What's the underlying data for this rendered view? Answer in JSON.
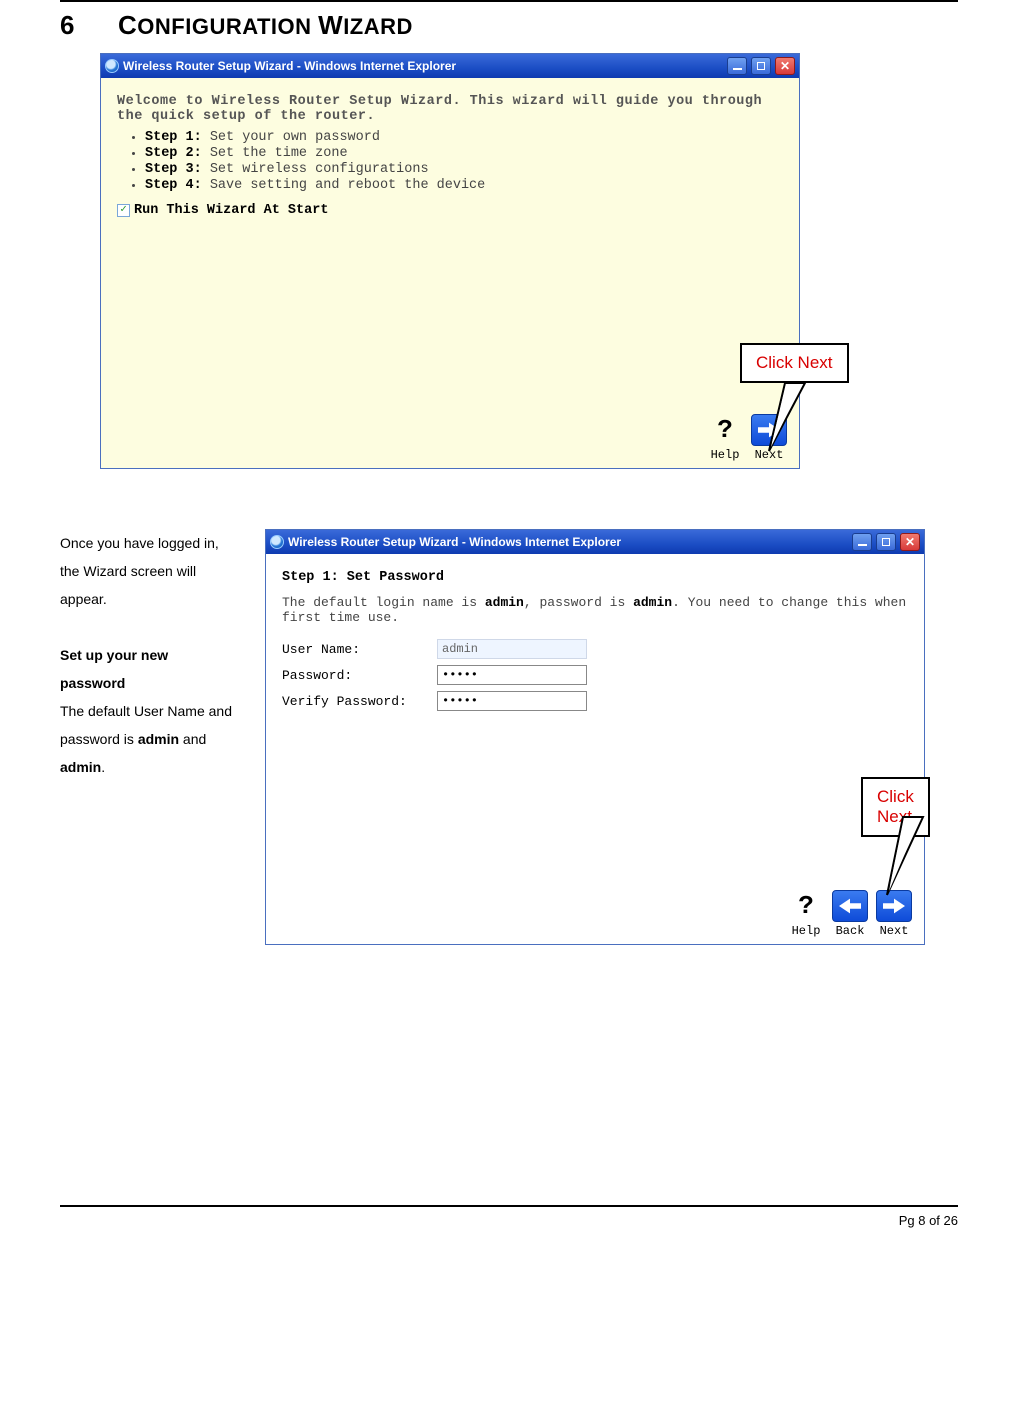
{
  "chapter": {
    "number": "6",
    "title_word1": "C",
    "title_rest": "ONFIGURATION ",
    "title_word2": "W",
    "title_rest2": "IZARD"
  },
  "heading_plain": "CONFIGURATION WIZARD",
  "win1": {
    "title": "Wireless Router Setup Wizard - Windows Internet Explorer",
    "welcome": "Welcome to Wireless Router Setup Wizard. This wizard will guide you through the quick setup of the router.",
    "steps": [
      {
        "bold": "Step 1:",
        "rest": " Set your own password"
      },
      {
        "bold": "Step 2:",
        "rest": " Set the time zone"
      },
      {
        "bold": "Step 3:",
        "rest": " Set wireless configurations"
      },
      {
        "bold": "Step 4:",
        "rest": " Save setting and reboot the device"
      }
    ],
    "run_label": "Run This Wizard At Start",
    "help_label": "Help",
    "next_label": "Next",
    "callout": "Click Next"
  },
  "side": {
    "p1": "Once you have logged in, the Wizard screen will appear.",
    "p2_bold": "Set up your new password",
    "p3a": "The default User Name and ",
    "p3b": "password is ",
    "p3c": "admin",
    "p3d": " and ",
    "p3e": "admin",
    "p3f": "."
  },
  "win2": {
    "title": "Wireless Router Setup Wizard - Windows Internet Explorer",
    "step_title": "Step 1: Set Password",
    "blurb_a": "The default login name is ",
    "blurb_b": "admin",
    "blurb_c": ", password is ",
    "blurb_d": "admin",
    "blurb_e": ". You need to change this when first time use.",
    "user_label": "User Name:",
    "user_value": "admin",
    "pass_label": "Password:",
    "pass_value": "•••••",
    "vpass_label": "Verify Password:",
    "vpass_value": "•••••",
    "help_label": "Help",
    "back_label": "Back",
    "next_label": "Next",
    "callout": "Click Next"
  },
  "footer": "Pg 8 of 26"
}
